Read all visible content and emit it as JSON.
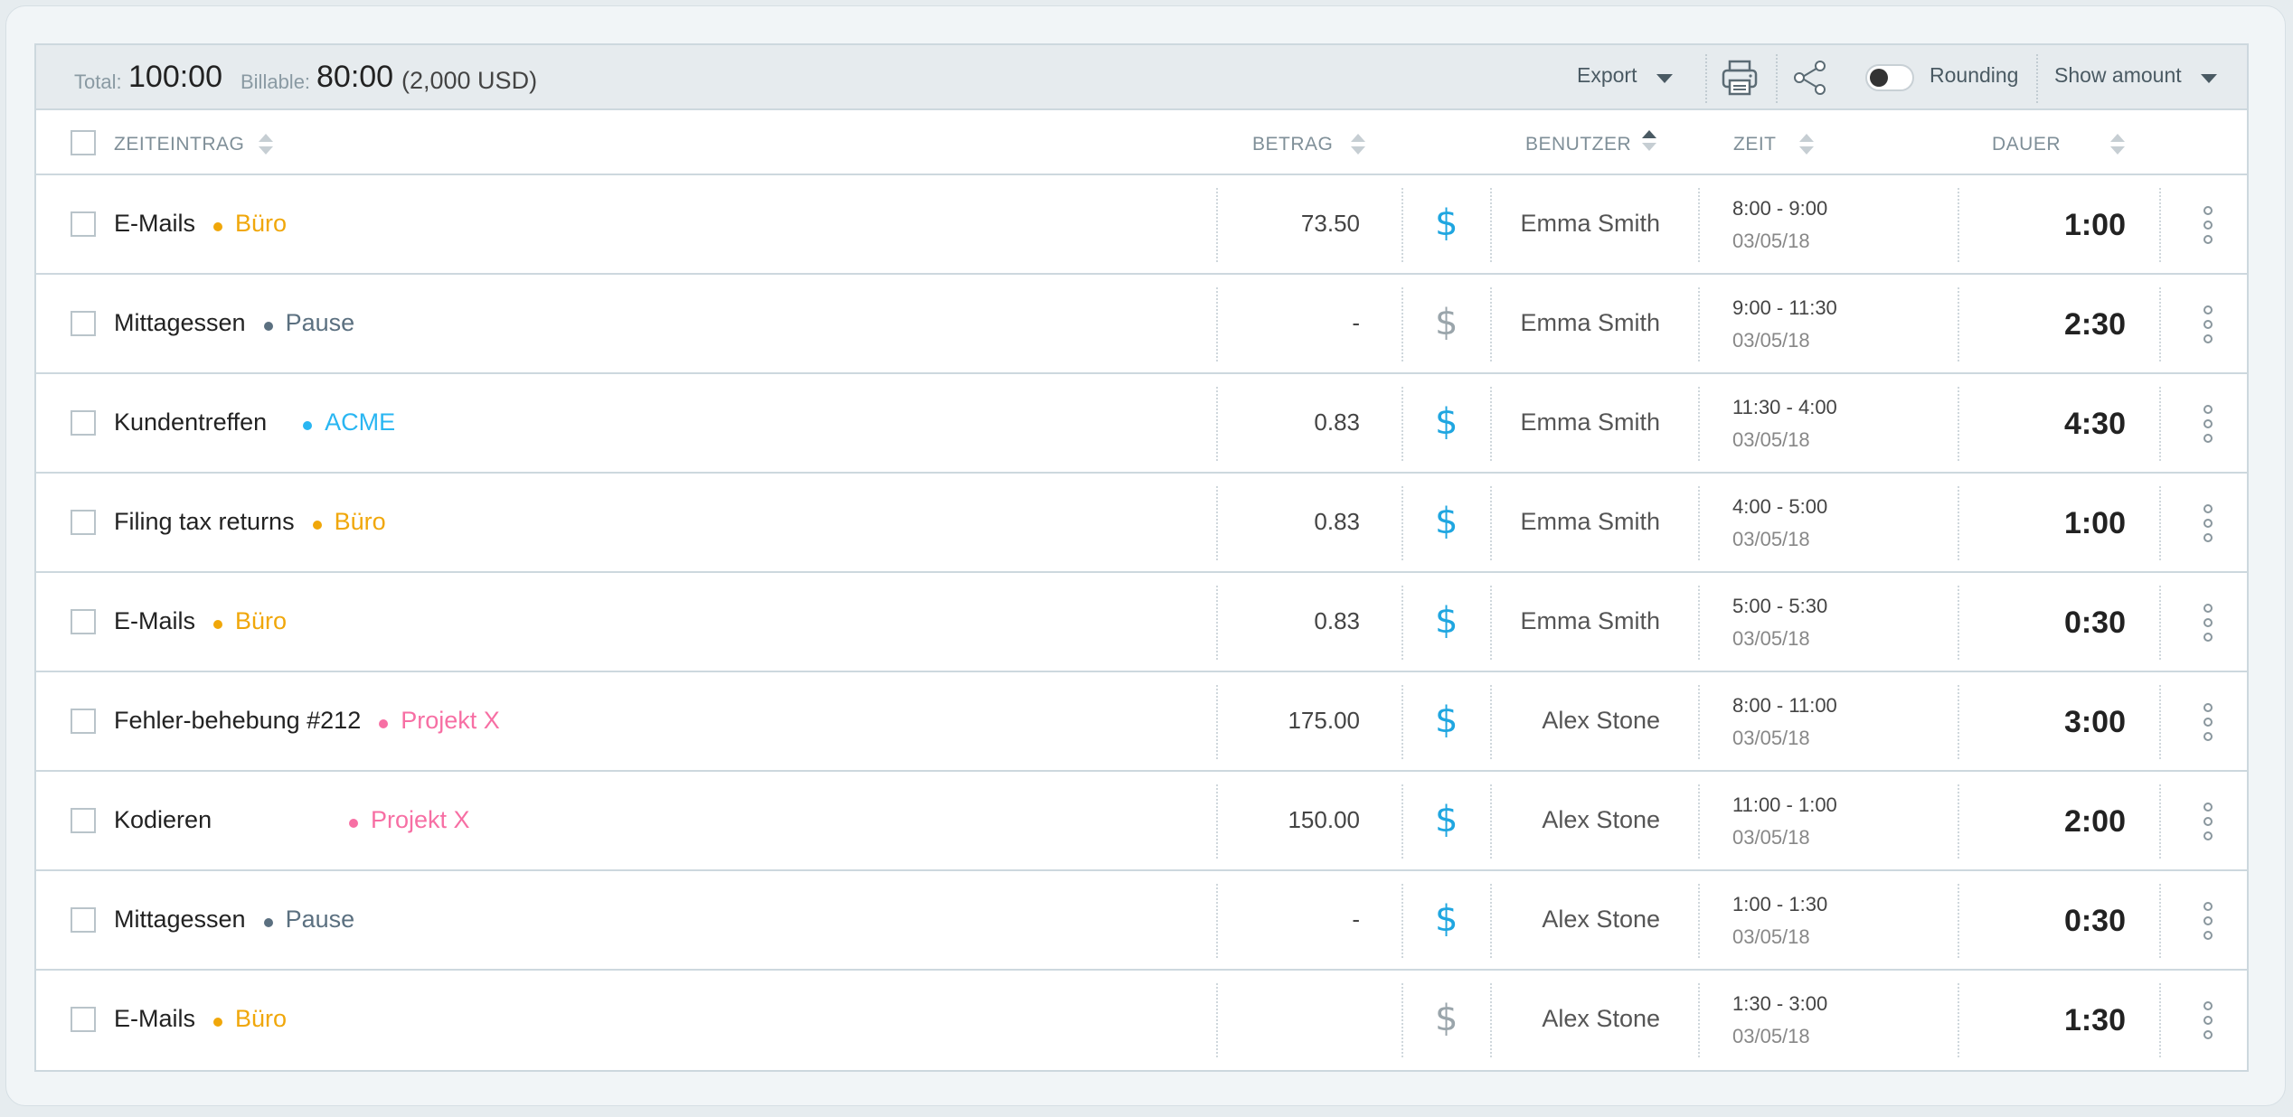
{
  "summary": {
    "total_label": "Total:",
    "total_value": "100:00",
    "billable_label": "Billable:",
    "billable_value": "80:00",
    "billable_amount": "(2,000 USD)"
  },
  "toolbar": {
    "export_label": "Export",
    "print_icon": "printer-icon",
    "share_icon": "share-icon",
    "rounding_label": "Rounding",
    "rounding_on": false,
    "show_amount_label": "Show amount"
  },
  "columns": {
    "entry": "ZEITEINTRAG",
    "amount": "BETRAG",
    "user": "BENUTZER",
    "time": "ZEIT",
    "duration": "DAUER"
  },
  "colors": {
    "Büro": "#f0a70a",
    "Pause": "#5b7080",
    "ACME": "#29b6f2",
    "Projekt X": "#f76fa4",
    "billable": "#1fa6e0",
    "non_billable": "#9aa5ab"
  },
  "rows": [
    {
      "entry": "E-Mails",
      "project": "Büro",
      "amount": "73.50",
      "billable": true,
      "user": "Emma Smith",
      "time": "8:00 - 9:00",
      "date": "03/05/18",
      "duration": "1:00"
    },
    {
      "entry": "Mittagessen",
      "project": "Pause",
      "amount": "-",
      "billable": false,
      "user": "Emma Smith",
      "time": "9:00 - 11:30",
      "date": "03/05/18",
      "duration": "2:30"
    },
    {
      "entry": "Kundentreffen",
      "project": "ACME",
      "amount": "0.83",
      "billable": true,
      "user": "Emma Smith",
      "time": "11:30 - 4:00",
      "date": "03/05/18",
      "duration": "4:30"
    },
    {
      "entry": "Filing tax returns",
      "project": "Büro",
      "amount": "0.83",
      "billable": true,
      "user": "Emma Smith",
      "time": "4:00 - 5:00",
      "date": "03/05/18",
      "duration": "1:00"
    },
    {
      "entry": "E-Mails",
      "project": "Büro",
      "amount": "0.83",
      "billable": true,
      "user": "Emma Smith",
      "time": "5:00 - 5:30",
      "date": "03/05/18",
      "duration": "0:30"
    },
    {
      "entry": "Fehler-behebung #212",
      "project": "Projekt X",
      "amount": "175.00",
      "billable": true,
      "user": "Alex Stone",
      "time": "8:00 - 11:00",
      "date": "03/05/18",
      "duration": "3:00"
    },
    {
      "entry": "Kodieren",
      "project": "Projekt X",
      "amount": "150.00",
      "billable": true,
      "user": "Alex Stone",
      "time": "11:00 - 1:00",
      "date": "03/05/18",
      "duration": "2:00"
    },
    {
      "entry": "Mittagessen",
      "project": "Pause",
      "amount": "-",
      "billable": true,
      "user": "Alex Stone",
      "time": "1:00 - 1:30",
      "date": "03/05/18",
      "duration": "0:30"
    },
    {
      "entry": "E-Mails",
      "project": "Büro",
      "amount": "",
      "billable": false,
      "user": "Alex Stone",
      "time": "1:30 - 3:00",
      "date": "03/05/18",
      "duration": "1:30"
    }
  ]
}
